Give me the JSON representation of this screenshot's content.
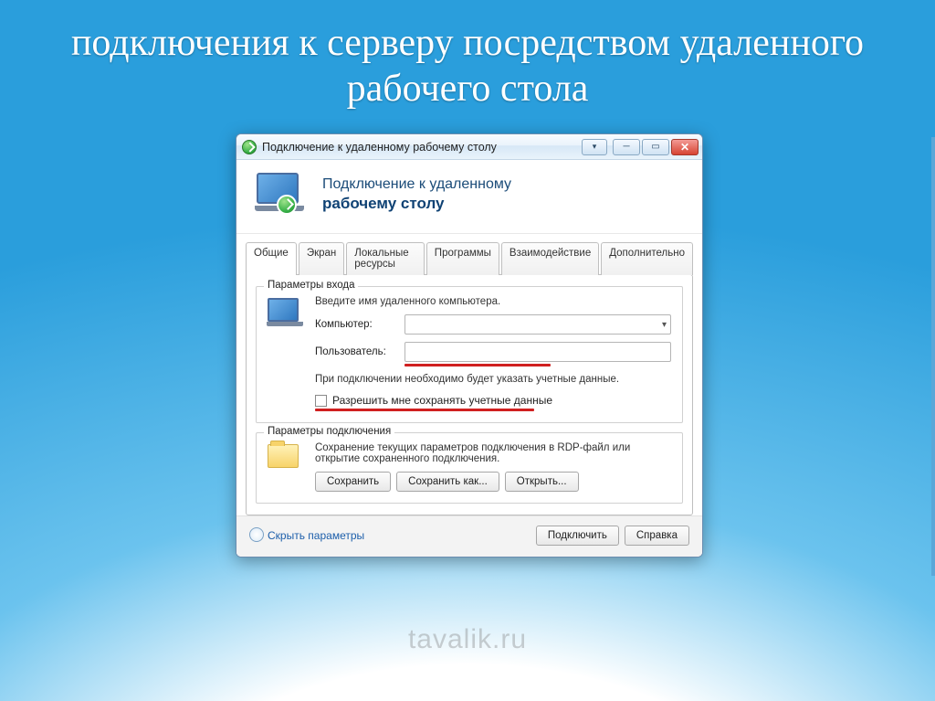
{
  "slide": {
    "title": "подключения к серверу посредством удаленного рабочего стола"
  },
  "window": {
    "title": "Подключение к удаленному рабочему столу",
    "banner_line1": "Подключение к удаленному",
    "banner_line2": "рабочему столу"
  },
  "tabs": [
    {
      "label": "Общие",
      "active": true
    },
    {
      "label": "Экран",
      "active": false
    },
    {
      "label": "Локальные ресурсы",
      "active": false
    },
    {
      "label": "Программы",
      "active": false
    },
    {
      "label": "Взаимодействие",
      "active": false
    },
    {
      "label": "Дополнительно",
      "active": false
    }
  ],
  "login_group": {
    "title": "Параметры входа",
    "hint": "Введите имя удаленного компьютера.",
    "computer_label": "Компьютер:",
    "user_label": "Пользователь:",
    "credentials_hint": "При подключении необходимо будет указать учетные данные.",
    "save_credentials_label": "Разрешить мне сохранять учетные данные"
  },
  "conn_group": {
    "title": "Параметры подключения",
    "hint": "Сохранение текущих параметров подключения в RDP-файл или открытие сохраненного подключения.",
    "save": "Сохранить",
    "save_as": "Сохранить как...",
    "open": "Открыть..."
  },
  "footer": {
    "hide_params": "Скрыть параметры",
    "connect": "Подключить",
    "help": "Справка"
  },
  "watermark": "tavalik.ru"
}
